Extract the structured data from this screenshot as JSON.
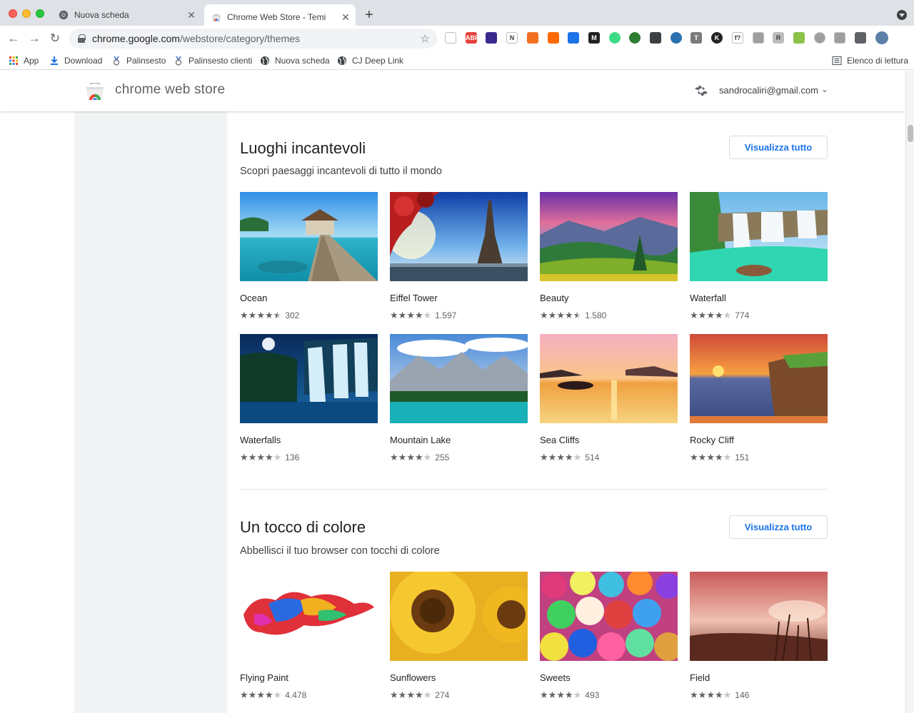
{
  "browser": {
    "tabs": [
      {
        "title": "Nuova scheda",
        "close": "✕"
      },
      {
        "title": "Chrome Web Store - Temi",
        "close": "✕"
      }
    ],
    "new_tab": "+",
    "url_host": "chrome.google.com",
    "url_path": "/webstore/category/themes",
    "bookmarks": [
      {
        "label": "App",
        "icon": "apps-grid-icon"
      },
      {
        "label": "Download",
        "icon": "download-icon"
      },
      {
        "label": "Palinsesto",
        "icon": "medal-icon"
      },
      {
        "label": "Palinsesto clienti",
        "icon": "medal-icon"
      },
      {
        "label": "Nuova scheda",
        "icon": "globe-icon"
      },
      {
        "label": "CJ Deep Link",
        "icon": "globe-icon"
      }
    ],
    "reading_list": "Elenco di lettura",
    "extensions": [
      {
        "icon": "calendar-ext-icon",
        "label": "",
        "color": "#ffffff"
      },
      {
        "icon": "adblock-ext-icon",
        "label": "ABP",
        "color": "#e5403a"
      },
      {
        "icon": "cube-ext-icon",
        "label": "",
        "color": "#3a2a8e"
      },
      {
        "icon": "notion-ext-icon",
        "label": "N",
        "color": "#ffffff"
      },
      {
        "icon": "layout-ext-icon",
        "label": "",
        "color": "#f26f21"
      },
      {
        "icon": "fire-ext-icon",
        "label": "",
        "color": "#ff6a00"
      },
      {
        "icon": "code-ext-icon",
        "label": "",
        "color": "#1a73e8"
      },
      {
        "icon": "m-ext-icon",
        "label": "M",
        "color": "#222222"
      },
      {
        "icon": "android-ext-icon",
        "label": "",
        "color": "#3ddc84"
      },
      {
        "icon": "globe-ext-icon",
        "label": "",
        "color": "#2e7d32"
      },
      {
        "icon": "eyedropper-ext-icon",
        "label": "",
        "color": "#3c4043"
      },
      {
        "icon": "aperture-ext-icon",
        "label": "",
        "color": "#2a6fb0"
      },
      {
        "icon": "t-ext-icon",
        "label": "T",
        "color": "#7a7a7a"
      },
      {
        "icon": "k-ext-icon",
        "label": "K",
        "color": "#222222"
      },
      {
        "icon": "font-ext-icon",
        "label": "f?",
        "color": "#ffffff"
      },
      {
        "icon": "window-ext-icon",
        "label": "",
        "color": "#9e9e9e"
      },
      {
        "icon": "r-ext-icon",
        "label": "R",
        "color": "#bdbdbd"
      },
      {
        "icon": "diamond-ext-icon",
        "label": "",
        "color": "#8bc34a"
      },
      {
        "icon": "check-ext-icon",
        "label": "",
        "color": "#9e9e9e"
      },
      {
        "icon": "link-ext-icon",
        "label": "",
        "color": "#9e9e9e"
      },
      {
        "icon": "puzzle-ext-icon",
        "label": "",
        "color": "#5f6368"
      },
      {
        "icon": "profile-avatar-icon",
        "label": "",
        "color": "#5b7fa8"
      }
    ]
  },
  "store": {
    "name": "chrome web store",
    "account": "sandrocaliri@gmail.com"
  },
  "sections": [
    {
      "title": "Luoghi incantevoli",
      "subtitle": "Scopri paesaggi incantevoli di tutto il mondo",
      "view_all": "Visualizza tutto",
      "themes": [
        {
          "name": "Ocean",
          "rating": 4.5,
          "count": "302"
        },
        {
          "name": "Eiffel Tower",
          "rating": 4,
          "count": "1.597"
        },
        {
          "name": "Beauty",
          "rating": 4.5,
          "count": "1.580"
        },
        {
          "name": "Waterfall",
          "rating": 4,
          "count": "774"
        },
        {
          "name": "Waterfalls",
          "rating": 4,
          "count": "136"
        },
        {
          "name": "Mountain Lake",
          "rating": 4,
          "count": "255"
        },
        {
          "name": "Sea Cliffs",
          "rating": 4,
          "count": "514"
        },
        {
          "name": "Rocky Cliff",
          "rating": 4,
          "count": "151"
        }
      ]
    },
    {
      "title": "Un tocco di colore",
      "subtitle": "Abbellisci il tuo browser con tocchi di colore",
      "view_all": "Visualizza tutto",
      "themes": [
        {
          "name": "Flying Paint",
          "rating": 4,
          "count": "4.478"
        },
        {
          "name": "Sunflowers",
          "rating": 4,
          "count": "274"
        },
        {
          "name": "Sweets",
          "rating": 4,
          "count": "493"
        },
        {
          "name": "Field",
          "rating": 4,
          "count": "146"
        }
      ]
    }
  ]
}
